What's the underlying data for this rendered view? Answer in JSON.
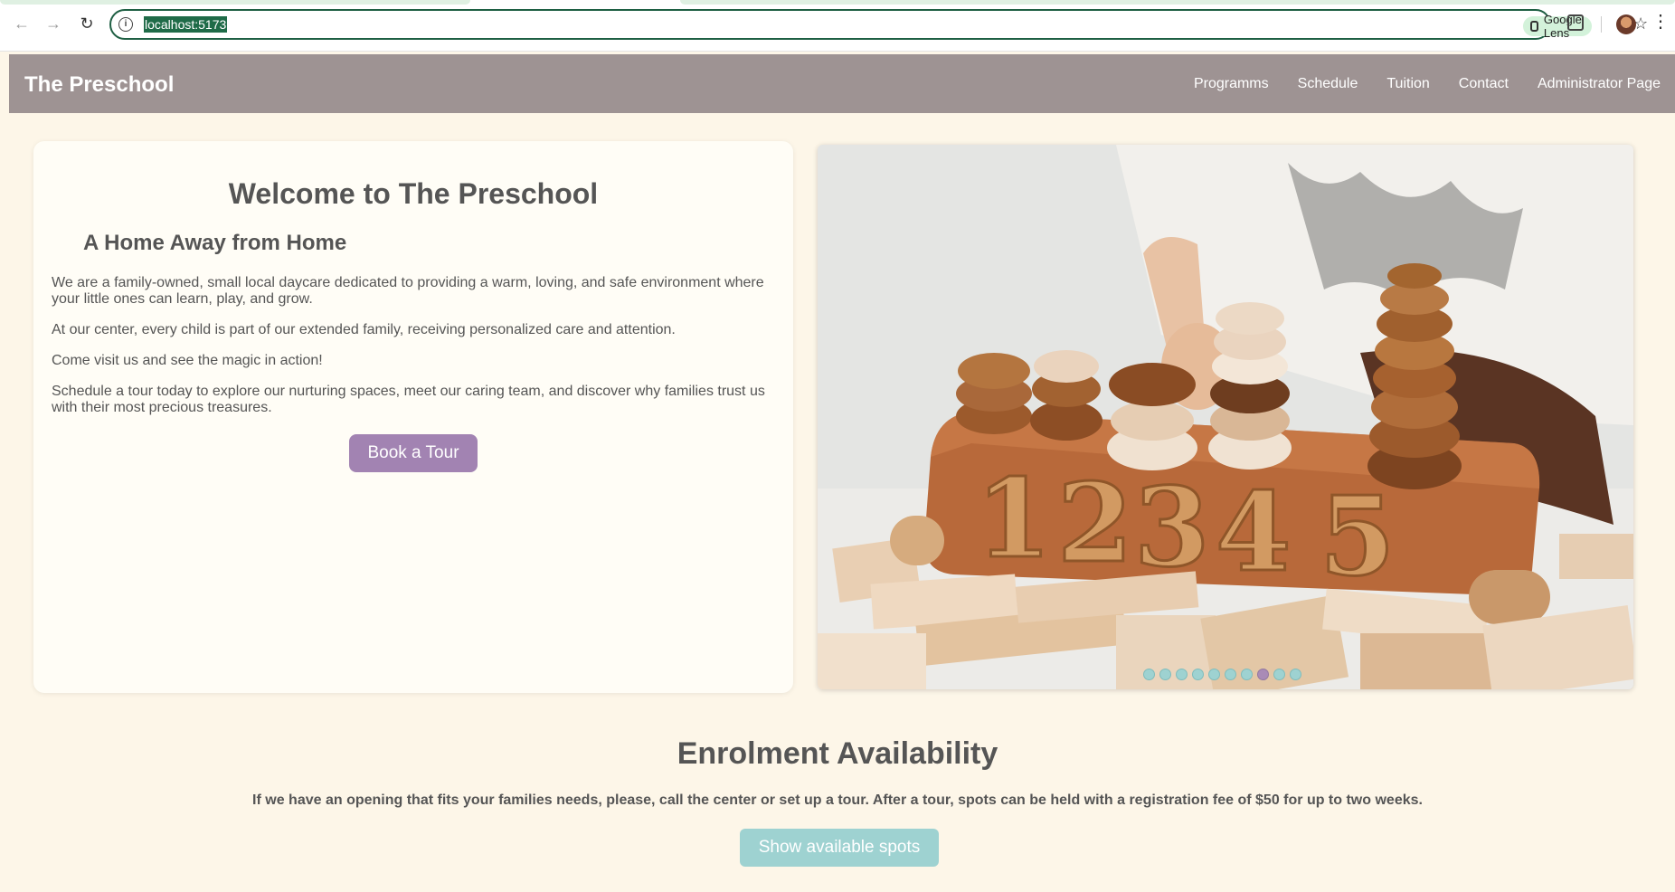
{
  "browser": {
    "url": "localhost:5173",
    "lens_label": "Google Lens",
    "icons": [
      "back-icon",
      "forward-icon",
      "reload-icon",
      "site-info-icon",
      "star-icon",
      "extensions-icon",
      "profile-avatar",
      "menu-icon"
    ]
  },
  "site": {
    "brand": "The Preschool",
    "nav": [
      "Programms",
      "Schedule",
      "Tuition",
      "Contact",
      "Administrator Page"
    ],
    "colors": {
      "navbar": "#9e9393",
      "primary_button": "#a283b2",
      "secondary_button": "#9ed2d1",
      "background": "#fdf6e8"
    }
  },
  "welcome": {
    "title": "Welcome to The Preschool",
    "subtitle": "A Home Away from Home",
    "paragraphs": [
      "We are a family-owned, small local daycare dedicated to providing a warm, loving, and safe environment where your little ones can learn, play, and grow.",
      "At our center, every child is part of our extended family, receiving personalized care and attention.",
      "Come visit us and see the magic in action!",
      "Schedule a tour today to explore our nurturing spaces, meet our caring team, and discover why families trust us with their most precious treasures."
    ],
    "cta": "Book a Tour"
  },
  "carousel": {
    "slide_count": 10,
    "active_index": 7,
    "image_digits": [
      "1",
      "2",
      "3",
      "4",
      "5"
    ]
  },
  "enrolment": {
    "title": "Enrolment Availability",
    "text": "If we have an opening that fits your families needs, please, call the center or set up a tour. After a tour, spots can be held with a registration fee of $50 for up to two weeks.",
    "button": "Show available spots"
  }
}
